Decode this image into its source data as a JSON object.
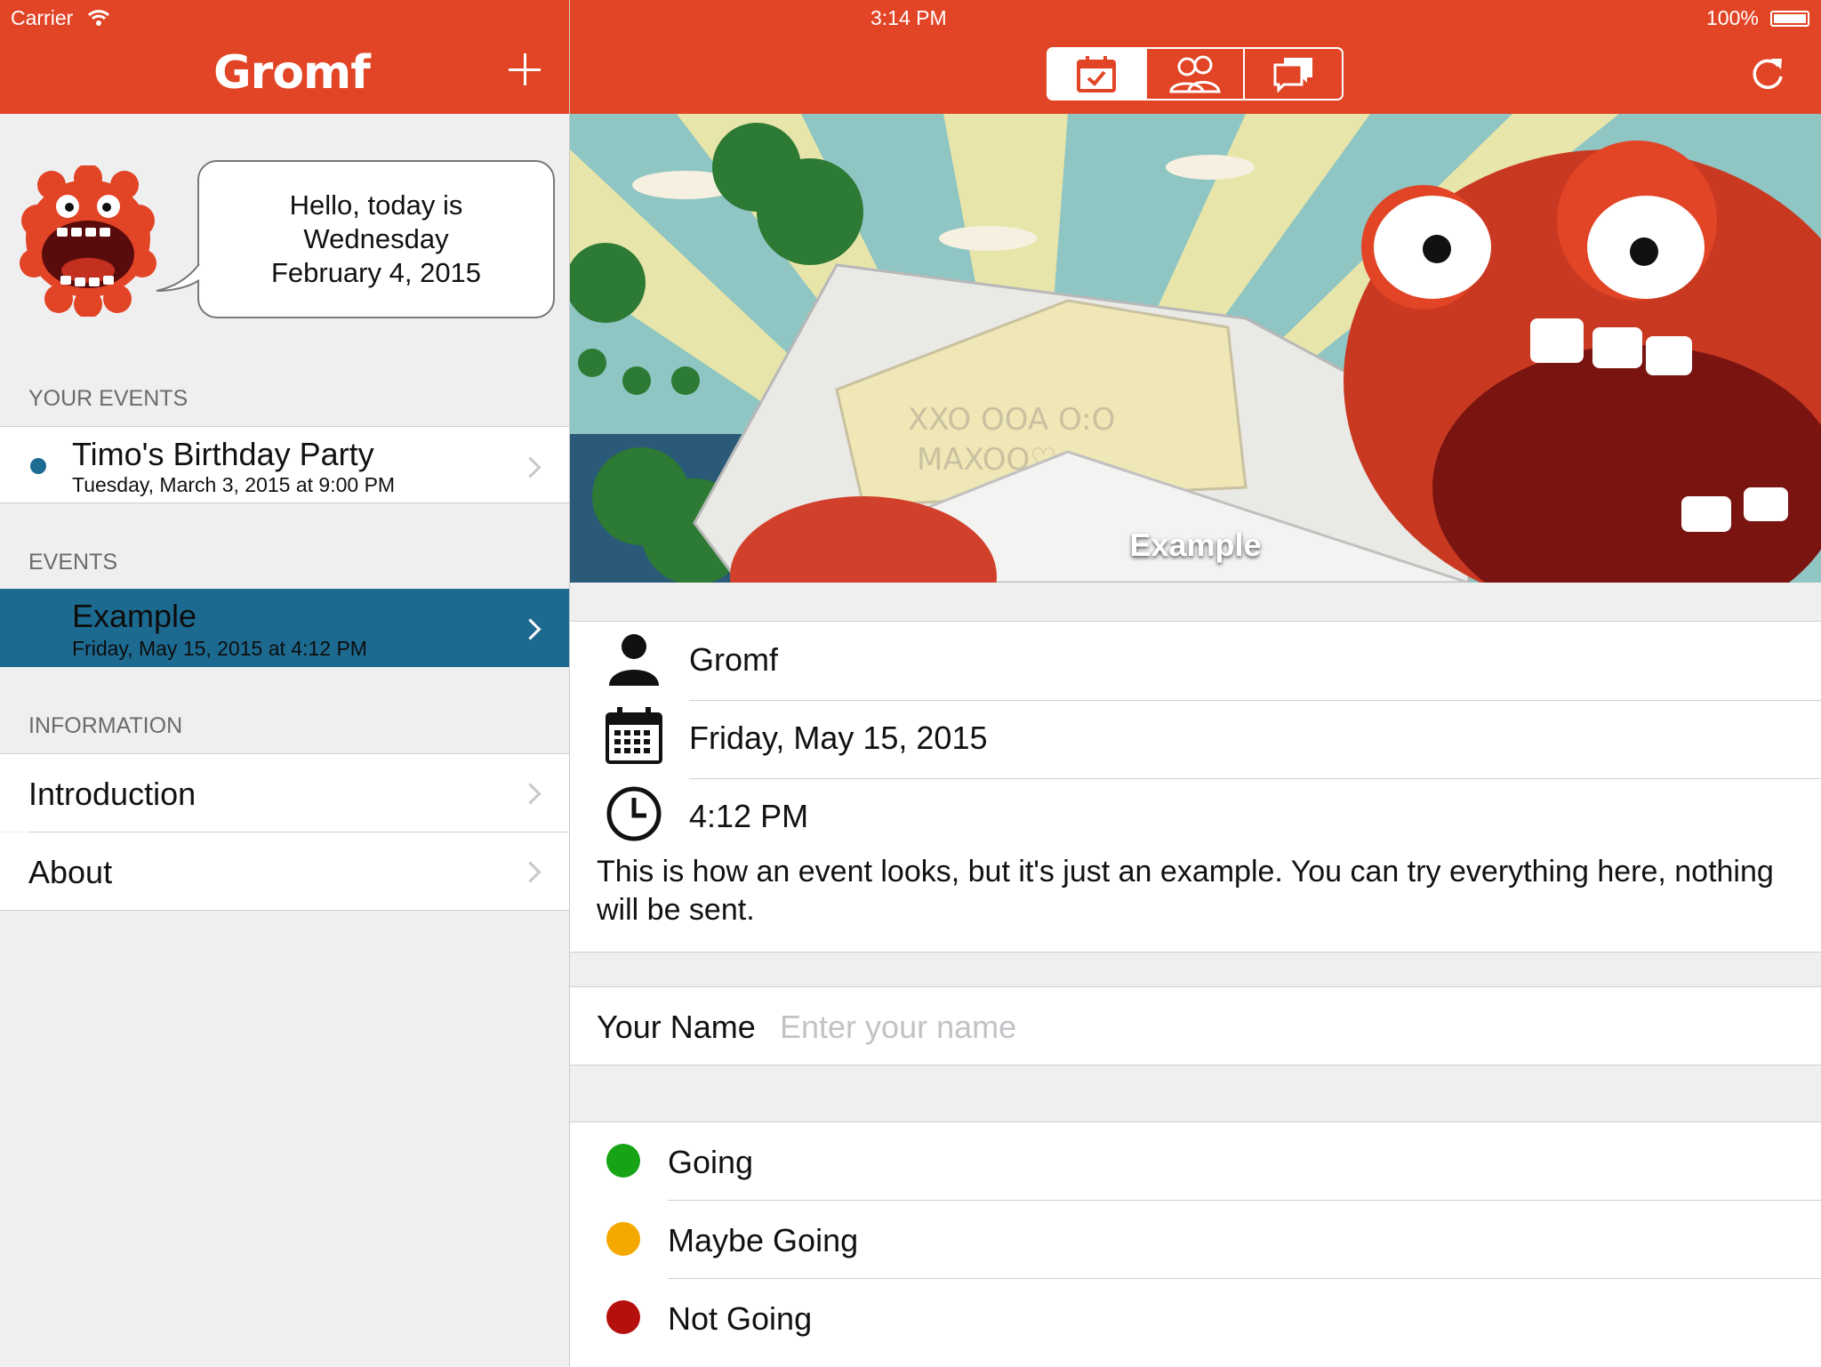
{
  "status_bar": {
    "carrier": "Carrier",
    "time": "3:14 PM",
    "battery": "100%"
  },
  "left_nav": {
    "brand": "Gromf",
    "add_icon": "plus-icon"
  },
  "right_nav": {
    "segments": [
      {
        "icon": "calendar-check-icon",
        "active": true
      },
      {
        "icon": "people-icon",
        "active": false
      },
      {
        "icon": "chat-bubbles-icon",
        "active": false
      }
    ],
    "refresh_icon": "refresh-icon"
  },
  "greeting": {
    "line1": "Hello, today is",
    "line2": "Wednesday",
    "line3": "February 4, 2015"
  },
  "sections": {
    "your_events": "YOUR EVENTS",
    "events": "EVENTS",
    "information": "INFORMATION"
  },
  "your_events": [
    {
      "title": "Timo's Birthday Party",
      "subtitle": "Tuesday, March 3, 2015 at 9:00 PM",
      "dot_color": "#1c6b93"
    }
  ],
  "events": [
    {
      "title": "Example",
      "subtitle": "Friday, May 15, 2015 at 4:12 PM",
      "selected": true
    }
  ],
  "information": [
    {
      "label": "Introduction"
    },
    {
      "label": "About"
    }
  ],
  "detail": {
    "hero_title": "Example",
    "organizer": "Gromf",
    "date": "Friday, May 15, 2015",
    "time": "4:12 PM",
    "description": "This is how an event looks, but it's just an example. You can try everything here, nothing will be sent.",
    "name_label": "Your Name",
    "name_placeholder": "Enter your name",
    "name_value": "",
    "rsvp": [
      {
        "label": "Going",
        "color": "#16a316"
      },
      {
        "label": "Maybe Going",
        "color": "#f5a800"
      },
      {
        "label": "Not Going",
        "color": "#b5100e"
      }
    ]
  },
  "colors": {
    "accent": "#e24426",
    "selected_row": "#1d6a91",
    "background": "#efefef"
  }
}
